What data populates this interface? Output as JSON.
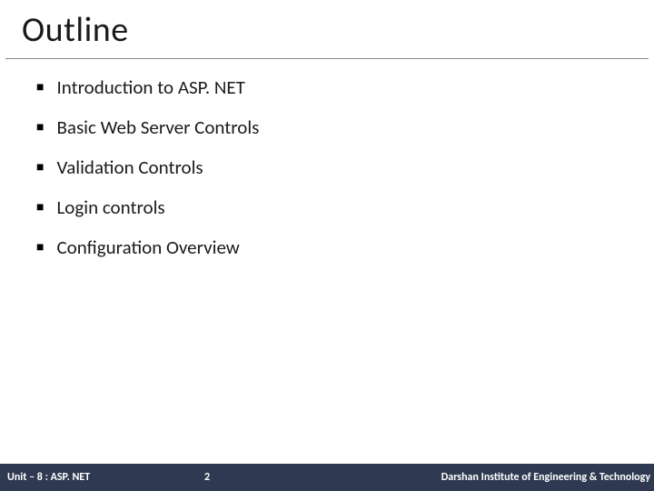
{
  "title": "Outline",
  "bullets": [
    "Introduction to ASP. NET",
    "Basic Web Server Controls",
    "Validation Controls",
    "Login controls",
    "Configuration Overview"
  ],
  "footer": {
    "unit": "Unit – 8 : ASP. NET",
    "page": "2",
    "institute": "Darshan Institute of Engineering & Technology"
  }
}
